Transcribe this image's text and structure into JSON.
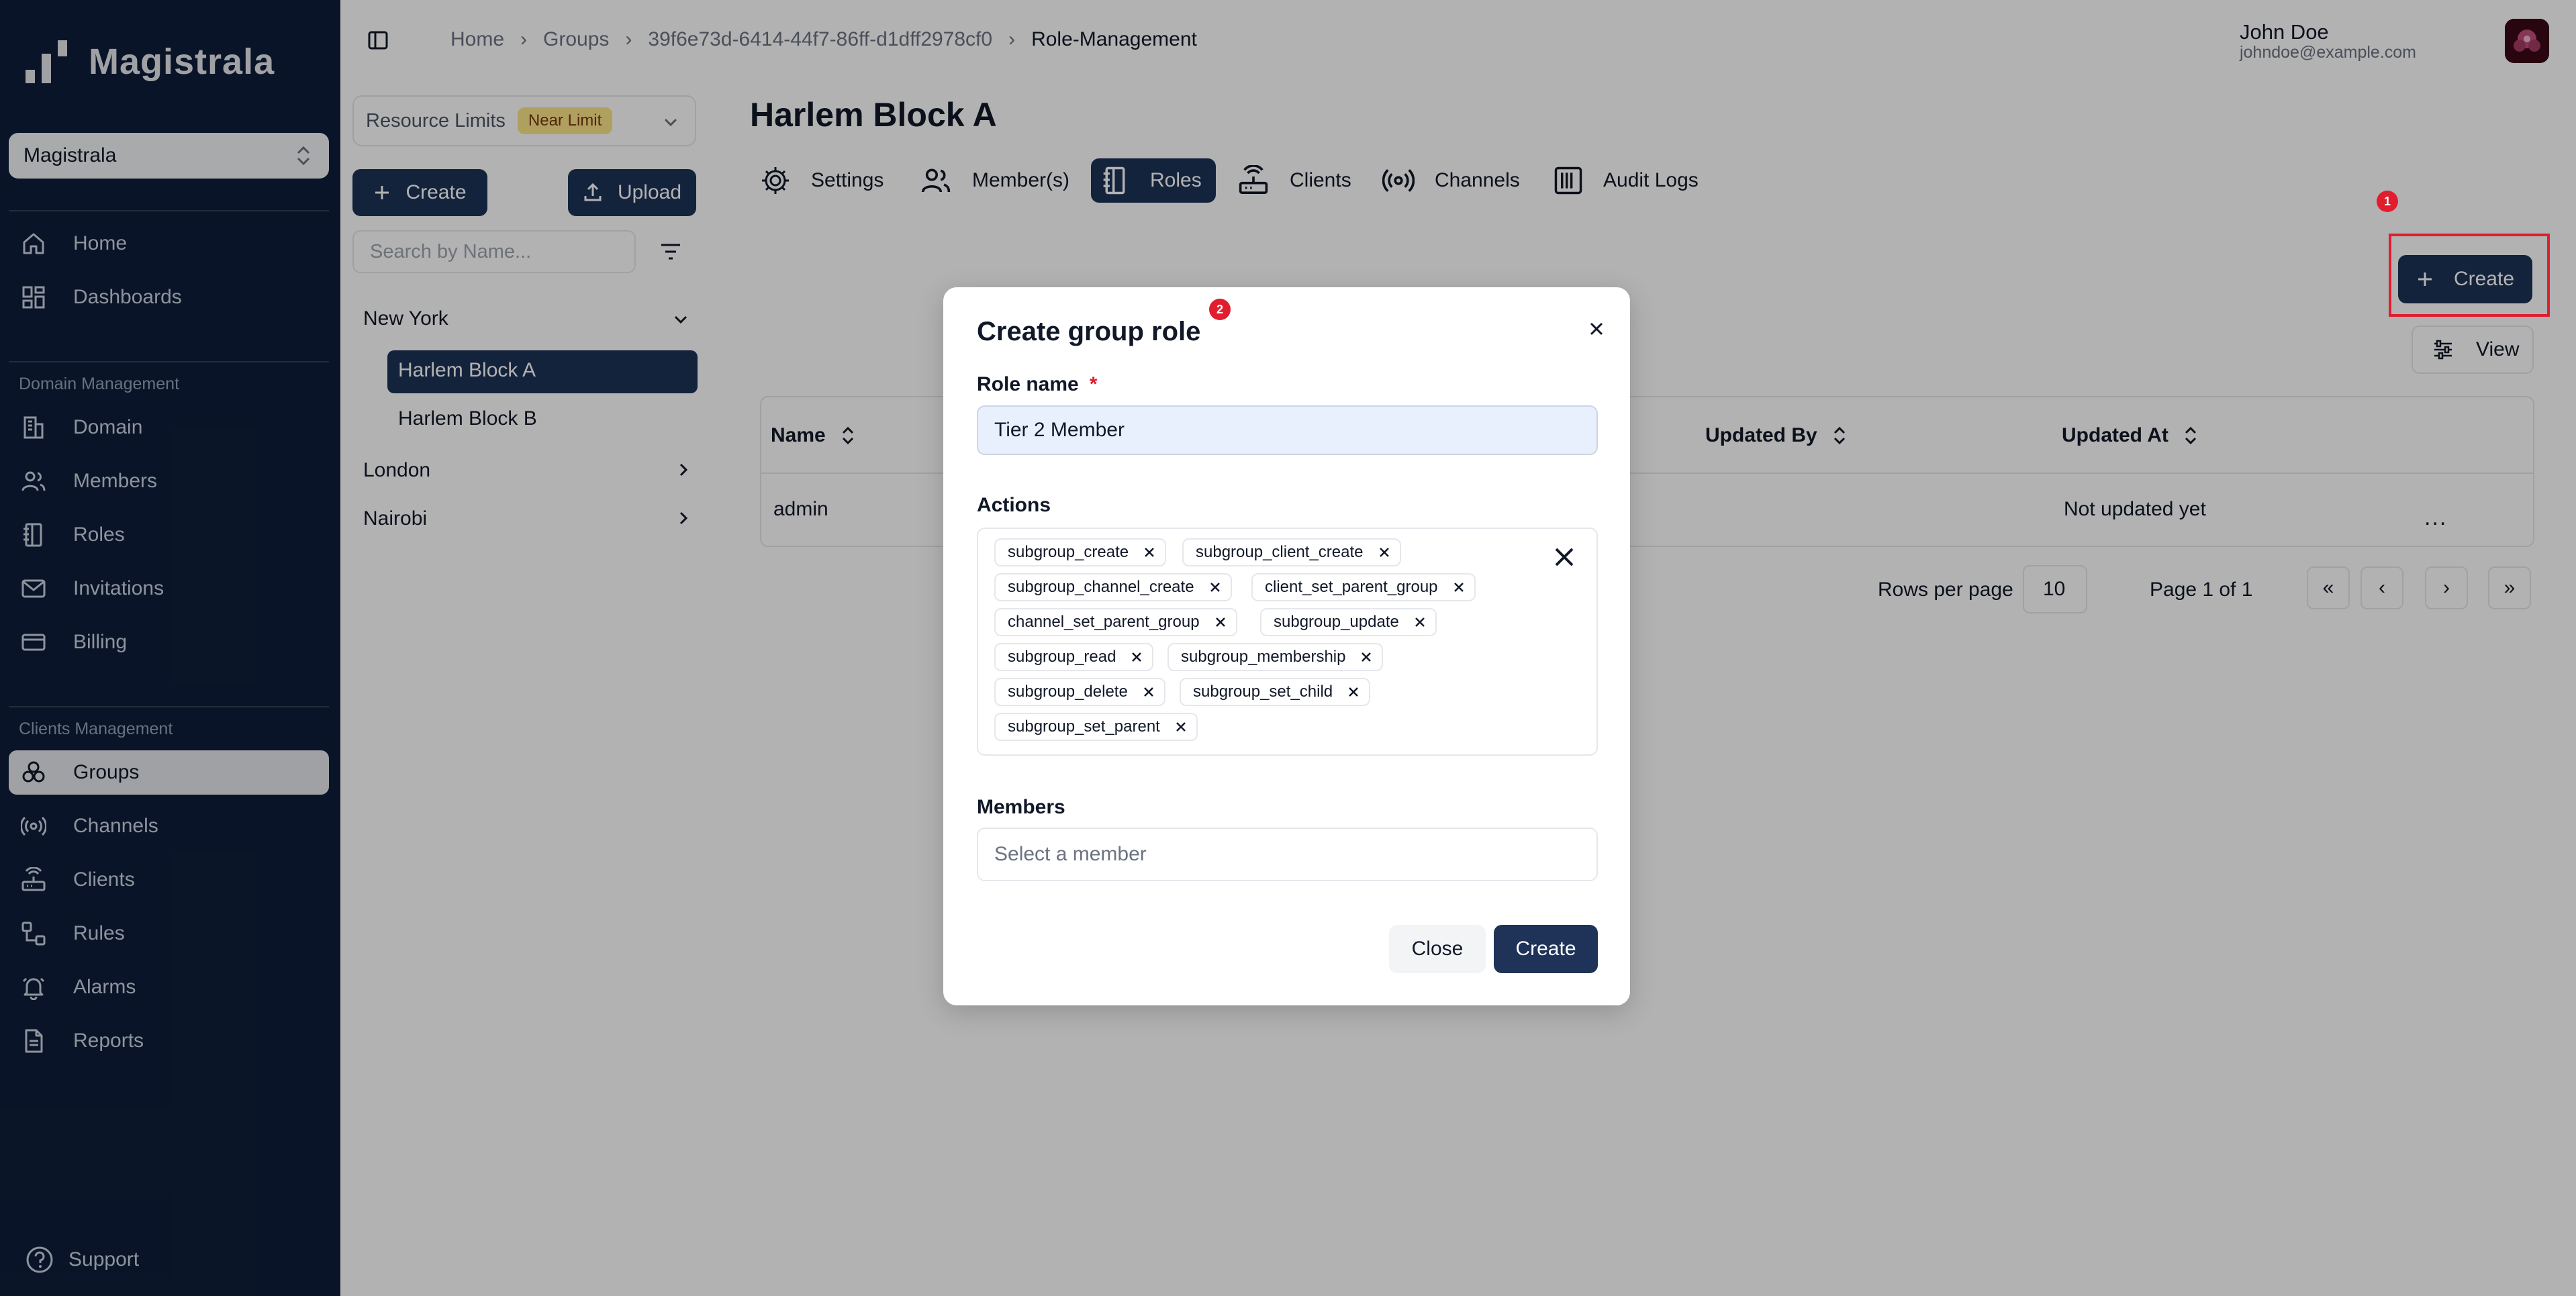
{
  "app": {
    "name": "Magistrala"
  },
  "sidebar": {
    "org_selector": "Magistrala",
    "items_top": [
      {
        "label": "Home",
        "icon": "home-icon"
      },
      {
        "label": "Dashboards",
        "icon": "dashboard-icon"
      }
    ],
    "domain_group_label": "Domain Management",
    "items_domain": [
      {
        "label": "Domain",
        "icon": "building-icon"
      },
      {
        "label": "Members",
        "icon": "users-icon"
      },
      {
        "label": "Roles",
        "icon": "notebook-icon"
      },
      {
        "label": "Invitations",
        "icon": "mail-icon"
      },
      {
        "label": "Billing",
        "icon": "credit-card-icon"
      }
    ],
    "clients_group_label": "Clients Management",
    "items_clients": [
      {
        "label": "Groups",
        "icon": "groups-icon",
        "active": true
      },
      {
        "label": "Channels",
        "icon": "radio-icon"
      },
      {
        "label": "Clients",
        "icon": "router-icon"
      },
      {
        "label": "Rules",
        "icon": "workflow-icon"
      },
      {
        "label": "Alarms",
        "icon": "bell-icon"
      },
      {
        "label": "Reports",
        "icon": "file-icon"
      }
    ],
    "support_label": "Support"
  },
  "breadcrumb": [
    "Home",
    "Groups",
    "39f6e73d-6414-44f7-86ff-d1dff2978cf0",
    "Role-Management"
  ],
  "user": {
    "name": "John Doe",
    "email": "johndoe@example.com"
  },
  "tree_panel": {
    "resource_limits_label": "Resource Limits",
    "resource_limits_badge": "Near Limit",
    "create_label": "Create",
    "upload_label": "Upload",
    "search_placeholder": "Search by Name...",
    "groups": [
      {
        "label": "New York",
        "expanded": true,
        "children": [
          "Harlem Block A",
          "Harlem Block B"
        ]
      },
      {
        "label": "London",
        "expanded": false
      },
      {
        "label": "Nairobi",
        "expanded": false
      }
    ],
    "selected": "Harlem Block A"
  },
  "main": {
    "title": "Harlem Block A",
    "tabs": [
      {
        "label": "Settings",
        "icon": "gear-icon"
      },
      {
        "label": "Member(s)",
        "icon": "users-icon"
      },
      {
        "label": "Roles",
        "icon": "notebook-icon",
        "active": true
      },
      {
        "label": "Clients",
        "icon": "router-icon"
      },
      {
        "label": "Channels",
        "icon": "radio-icon"
      },
      {
        "label": "Audit Logs",
        "icon": "logs-icon"
      }
    ],
    "create_label": "Create",
    "view_label": "View",
    "table": {
      "columns": [
        "Name",
        "Updated By",
        "Updated At"
      ],
      "rows": [
        {
          "name": "admin",
          "updated_at": "Not updated yet"
        }
      ],
      "row_menu": "..."
    },
    "pagination": {
      "rows_per_page_label": "Rows per page",
      "rows_per_page": "10",
      "page_label": "Page 1 of 1",
      "first": "«",
      "prev": "‹",
      "next": "›",
      "last": "»"
    }
  },
  "markers": {
    "m1": "1",
    "m2": "2"
  },
  "modal": {
    "title": "Create group role",
    "role_name_label": "Role name",
    "required_mark": "*",
    "role_name_value": "Tier 2 Member",
    "actions_label": "Actions",
    "actions": [
      "subgroup_create",
      "subgroup_client_create",
      "subgroup_channel_create",
      "client_set_parent_group",
      "channel_set_parent_group",
      "subgroup_update",
      "subgroup_read",
      "subgroup_membership",
      "subgroup_delete",
      "subgroup_set_child",
      "subgroup_set_parent"
    ],
    "members_label": "Members",
    "members_placeholder": "Select a member",
    "close_label": "Close",
    "create_label": "Create"
  },
  "colors": {
    "sidebar_bg": "#0f1e3a",
    "primary": "#1e3357",
    "accent_red": "#e11d2e",
    "badge_yellow": "#fde68a"
  }
}
